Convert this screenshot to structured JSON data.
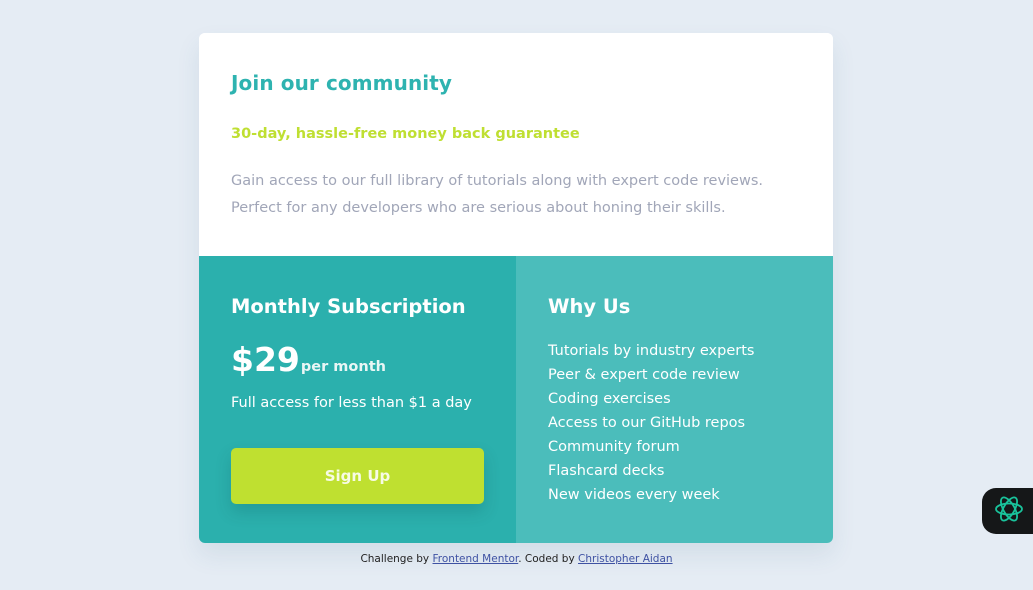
{
  "community": {
    "title": "Join our community",
    "guarantee": "30-day, hassle-free money back guarantee",
    "description": "Gain access to our full library of tutorials along with expert code reviews. Perfect for any developers who are serious about honing their skills."
  },
  "subscription": {
    "title": "Monthly Subscription",
    "price": "$29",
    "period": "per month",
    "note": "Full access for less than $1 a day",
    "button_label": "Sign Up"
  },
  "why_us": {
    "title": "Why Us",
    "items": [
      "Tutorials by industry experts",
      "Peer & expert code review",
      "Coding exercises",
      "Access to our GitHub repos",
      "Community forum",
      "Flashcard decks",
      "New videos every week"
    ]
  },
  "attribution": {
    "prefix": "Challenge by",
    "link1": "Frontend Mentor",
    "middle": ". Coded by",
    "link2": "Christopher Aidan"
  },
  "widget": {
    "icon": "assistant-flower-icon"
  },
  "colors": {
    "background": "#e5ecf4",
    "accent_teal": "#2eb3b0",
    "accent_lime": "#bfdf32",
    "panel_dark": "#2bb0ad",
    "panel_light": "#4bbdbb"
  }
}
